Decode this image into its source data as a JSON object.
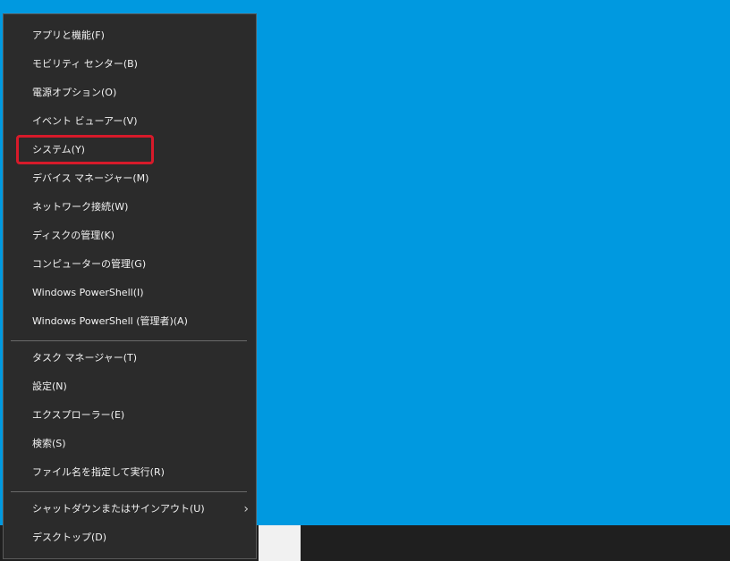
{
  "menu": {
    "groups": [
      {
        "items": [
          {
            "label": "アプリと機能(F)"
          },
          {
            "label": "モビリティ センター(B)"
          },
          {
            "label": "電源オプション(O)"
          },
          {
            "label": "イベント ビューアー(V)"
          },
          {
            "label": "システム(Y)"
          },
          {
            "label": "デバイス マネージャー(M)"
          },
          {
            "label": "ネットワーク接続(W)"
          },
          {
            "label": "ディスクの管理(K)"
          },
          {
            "label": "コンピューターの管理(G)"
          },
          {
            "label": "Windows PowerShell(I)"
          },
          {
            "label": "Windows PowerShell (管理者)(A)"
          }
        ]
      },
      {
        "items": [
          {
            "label": "タスク マネージャー(T)"
          },
          {
            "label": "設定(N)"
          },
          {
            "label": "エクスプローラー(E)"
          },
          {
            "label": "検索(S)"
          },
          {
            "label": "ファイル名を指定して実行(R)"
          }
        ]
      },
      {
        "items": [
          {
            "label": "シャットダウンまたはサインアウト(U)",
            "submenu_icon": "chevron-right-icon"
          },
          {
            "label": "デスクトップ(D)"
          }
        ]
      }
    ],
    "highlighted_item": "システム(Y)"
  },
  "colors": {
    "desktop": "#0099e0",
    "menu_background": "#2b2b2b",
    "menu_text": "#f2f2f2",
    "highlight": "#d71a2a",
    "taskbar": "#1f1f1f"
  }
}
